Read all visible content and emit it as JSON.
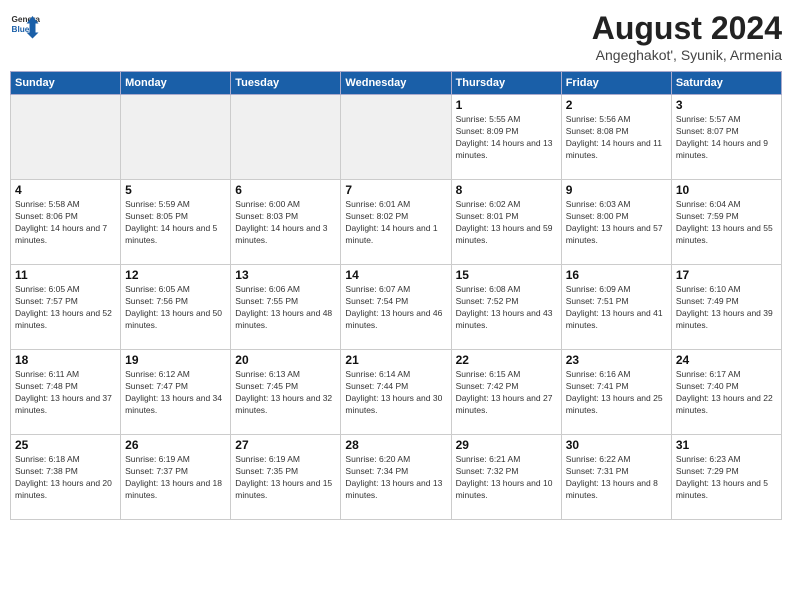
{
  "logo": {
    "general": "General",
    "blue": "Blue"
  },
  "header": {
    "title": "August 2024",
    "subtitle": "Angeghakot', Syunik, Armenia"
  },
  "days_of_week": [
    "Sunday",
    "Monday",
    "Tuesday",
    "Wednesday",
    "Thursday",
    "Friday",
    "Saturday"
  ],
  "weeks": [
    [
      {
        "day": "",
        "empty": true
      },
      {
        "day": "",
        "empty": true
      },
      {
        "day": "",
        "empty": true
      },
      {
        "day": "",
        "empty": true
      },
      {
        "day": "1",
        "sunrise": "5:55 AM",
        "sunset": "8:09 PM",
        "daylight": "14 hours and 13 minutes."
      },
      {
        "day": "2",
        "sunrise": "5:56 AM",
        "sunset": "8:08 PM",
        "daylight": "14 hours and 11 minutes."
      },
      {
        "day": "3",
        "sunrise": "5:57 AM",
        "sunset": "8:07 PM",
        "daylight": "14 hours and 9 minutes."
      }
    ],
    [
      {
        "day": "4",
        "sunrise": "5:58 AM",
        "sunset": "8:06 PM",
        "daylight": "14 hours and 7 minutes."
      },
      {
        "day": "5",
        "sunrise": "5:59 AM",
        "sunset": "8:05 PM",
        "daylight": "14 hours and 5 minutes."
      },
      {
        "day": "6",
        "sunrise": "6:00 AM",
        "sunset": "8:03 PM",
        "daylight": "14 hours and 3 minutes."
      },
      {
        "day": "7",
        "sunrise": "6:01 AM",
        "sunset": "8:02 PM",
        "daylight": "14 hours and 1 minute."
      },
      {
        "day": "8",
        "sunrise": "6:02 AM",
        "sunset": "8:01 PM",
        "daylight": "13 hours and 59 minutes."
      },
      {
        "day": "9",
        "sunrise": "6:03 AM",
        "sunset": "8:00 PM",
        "daylight": "13 hours and 57 minutes."
      },
      {
        "day": "10",
        "sunrise": "6:04 AM",
        "sunset": "7:59 PM",
        "daylight": "13 hours and 55 minutes."
      }
    ],
    [
      {
        "day": "11",
        "sunrise": "6:05 AM",
        "sunset": "7:57 PM",
        "daylight": "13 hours and 52 minutes."
      },
      {
        "day": "12",
        "sunrise": "6:05 AM",
        "sunset": "7:56 PM",
        "daylight": "13 hours and 50 minutes."
      },
      {
        "day": "13",
        "sunrise": "6:06 AM",
        "sunset": "7:55 PM",
        "daylight": "13 hours and 48 minutes."
      },
      {
        "day": "14",
        "sunrise": "6:07 AM",
        "sunset": "7:54 PM",
        "daylight": "13 hours and 46 minutes."
      },
      {
        "day": "15",
        "sunrise": "6:08 AM",
        "sunset": "7:52 PM",
        "daylight": "13 hours and 43 minutes."
      },
      {
        "day": "16",
        "sunrise": "6:09 AM",
        "sunset": "7:51 PM",
        "daylight": "13 hours and 41 minutes."
      },
      {
        "day": "17",
        "sunrise": "6:10 AM",
        "sunset": "7:49 PM",
        "daylight": "13 hours and 39 minutes."
      }
    ],
    [
      {
        "day": "18",
        "sunrise": "6:11 AM",
        "sunset": "7:48 PM",
        "daylight": "13 hours and 37 minutes."
      },
      {
        "day": "19",
        "sunrise": "6:12 AM",
        "sunset": "7:47 PM",
        "daylight": "13 hours and 34 minutes."
      },
      {
        "day": "20",
        "sunrise": "6:13 AM",
        "sunset": "7:45 PM",
        "daylight": "13 hours and 32 minutes."
      },
      {
        "day": "21",
        "sunrise": "6:14 AM",
        "sunset": "7:44 PM",
        "daylight": "13 hours and 30 minutes."
      },
      {
        "day": "22",
        "sunrise": "6:15 AM",
        "sunset": "7:42 PM",
        "daylight": "13 hours and 27 minutes."
      },
      {
        "day": "23",
        "sunrise": "6:16 AM",
        "sunset": "7:41 PM",
        "daylight": "13 hours and 25 minutes."
      },
      {
        "day": "24",
        "sunrise": "6:17 AM",
        "sunset": "7:40 PM",
        "daylight": "13 hours and 22 minutes."
      }
    ],
    [
      {
        "day": "25",
        "sunrise": "6:18 AM",
        "sunset": "7:38 PM",
        "daylight": "13 hours and 20 minutes."
      },
      {
        "day": "26",
        "sunrise": "6:19 AM",
        "sunset": "7:37 PM",
        "daylight": "13 hours and 18 minutes."
      },
      {
        "day": "27",
        "sunrise": "6:19 AM",
        "sunset": "7:35 PM",
        "daylight": "13 hours and 15 minutes."
      },
      {
        "day": "28",
        "sunrise": "6:20 AM",
        "sunset": "7:34 PM",
        "daylight": "13 hours and 13 minutes."
      },
      {
        "day": "29",
        "sunrise": "6:21 AM",
        "sunset": "7:32 PM",
        "daylight": "13 hours and 10 minutes."
      },
      {
        "day": "30",
        "sunrise": "6:22 AM",
        "sunset": "7:31 PM",
        "daylight": "13 hours and 8 minutes."
      },
      {
        "day": "31",
        "sunrise": "6:23 AM",
        "sunset": "7:29 PM",
        "daylight": "13 hours and 5 minutes."
      }
    ]
  ]
}
